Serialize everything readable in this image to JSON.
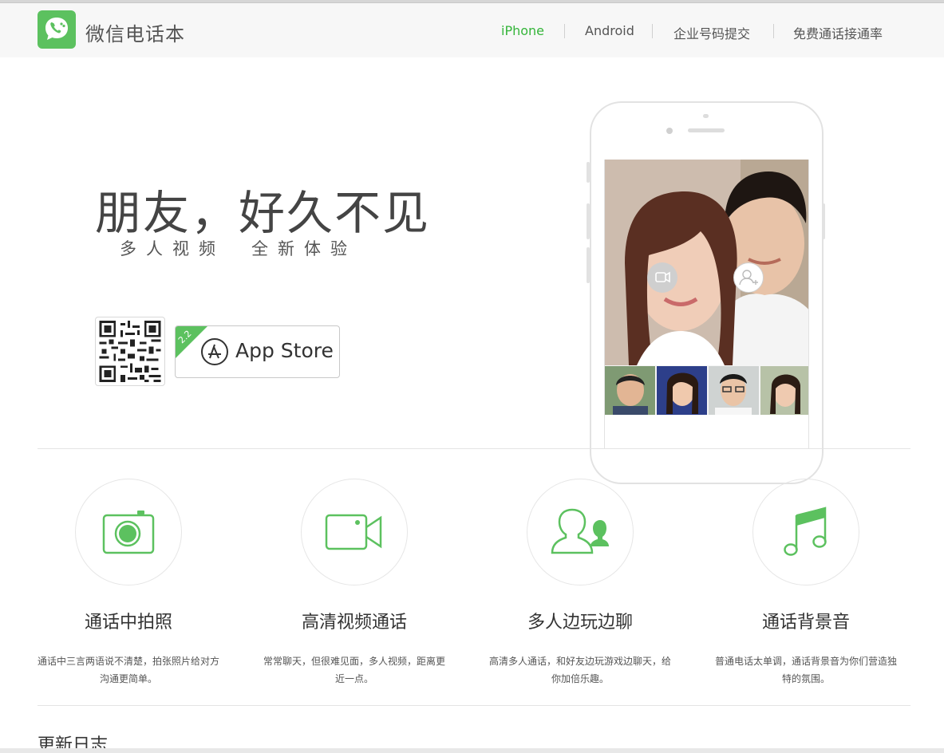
{
  "header": {
    "logo_text": "微信电话本",
    "nav": [
      {
        "label": "iPhone",
        "active": true
      },
      {
        "label": "Android",
        "active": false
      },
      {
        "label": "企业号码提交",
        "active": false
      },
      {
        "label": "免费通话接通率",
        "active": false
      }
    ]
  },
  "hero": {
    "title": "朋友，好久不见",
    "subtitle": "多人视频　全新体验",
    "appstore_label": "App Store",
    "badge": "2.2"
  },
  "features": [
    {
      "icon": "camera-icon",
      "title": "通话中拍照",
      "desc": "通话中三言两语说不清楚，拍张照片给对方沟通更简单。"
    },
    {
      "icon": "video-icon",
      "title": "高清视频通话",
      "desc": "常常聊天，但很难见面，多人视频，距离更近一点。"
    },
    {
      "icon": "group-icon",
      "title": "多人边玩边聊",
      "desc": "高清多人通话，和好友边玩游戏边聊天，给你加倍乐趣。"
    },
    {
      "icon": "music-note-icon",
      "title": "通话背景音",
      "desc": "普通电话太单调，通话背景音为你们营造独特的氛围。"
    }
  ],
  "changelog": {
    "title": "更新日志"
  },
  "colors": {
    "accent": "#5cc15f",
    "nav_active": "#35b53a"
  }
}
